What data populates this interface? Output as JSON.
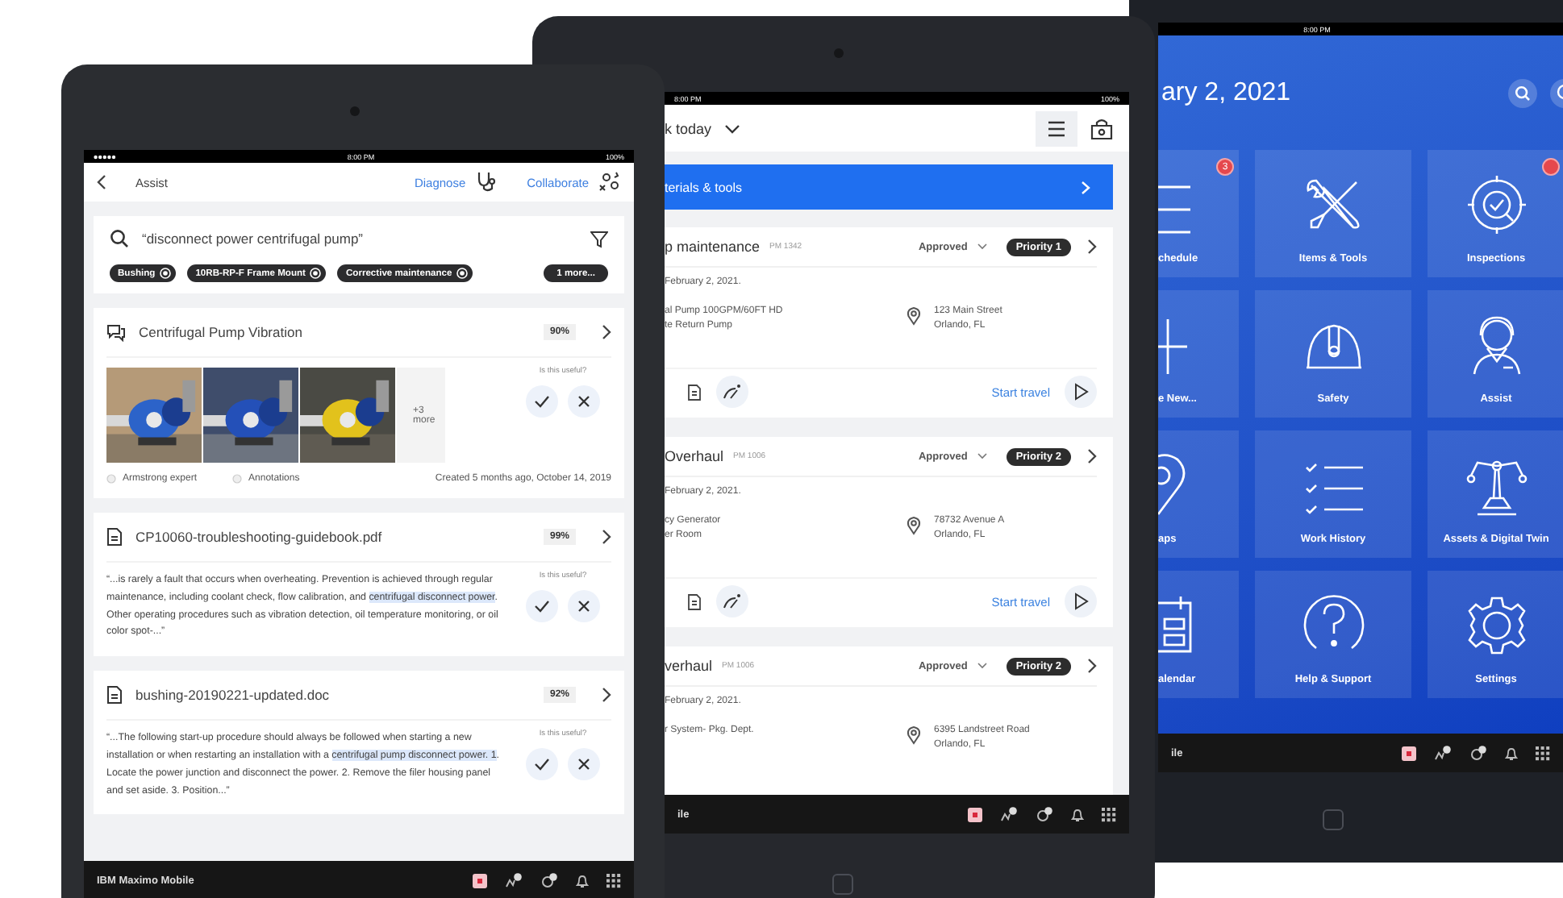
{
  "assist_tablet": {
    "status_bar": {
      "time": "8:00 PM",
      "battery": "100%"
    },
    "header": {
      "title": "Assist",
      "actions": [
        {
          "label": "Diagnose"
        },
        {
          "label": "Collaborate"
        }
      ]
    },
    "search": {
      "value": "“disconnect power centrifugal pump”",
      "chips": [
        {
          "label": "Bushing",
          "removable": true
        },
        {
          "label": "10RB-RP-F Frame Mount",
          "removable": true
        },
        {
          "label": "Corrective maintenance",
          "removable": true
        },
        {
          "label": "1 more...",
          "removable": false
        }
      ]
    },
    "results": [
      {
        "kind": "media",
        "title": "Centrifugal Pump Vibration",
        "score": "90%",
        "more_label": "+3 more",
        "feedback_prompt": "Is this useful?",
        "author": "Armstrong expert",
        "annotations": "Annotations",
        "created": "Created 5 months ago, October 14, 2019"
      },
      {
        "kind": "document",
        "title": "CP10060-troubleshooting-guidebook.pdf",
        "score": "99%",
        "feedback_prompt": "Is this useful?",
        "excerpt": [
          {
            "text": "“...is rarely a fault that occurs when overheating. Prevention is achieved through regular maintenance, including coolant check, flow calibration, and ",
            "highlighted": false
          },
          {
            "text": "centrifugal disconnect power",
            "highlighted": true
          },
          {
            "text": ". Other operating procedures such as vibration detection, oil temperature monitoring, or oil color spot-...”",
            "highlighted": false
          }
        ]
      },
      {
        "kind": "document",
        "title": "bushing-20190221-updated.doc",
        "score": "92%",
        "feedback_prompt": "Is this useful?",
        "excerpt": [
          {
            "text": "“...The following start-up procedure should always be followed when starting a new installation or when restarting an installation with a ",
            "highlighted": false
          },
          {
            "text": "centrifugal pump disconnect power. 1",
            "highlighted": true
          },
          {
            "text": ". Locate the power junction and disconnect the power. 2. Remove the filer housing panel and set aside. 3. Position...”",
            "highlighted": false
          }
        ]
      }
    ],
    "bottom_bar": {
      "brand": "IBM Maximo Mobile"
    }
  },
  "work_list_tablet": {
    "status_bar": {
      "time": "8:00 PM",
      "battery": "100%"
    },
    "header": {
      "title": "k today"
    },
    "banner": {
      "label": "terials & tools"
    },
    "work_orders": [
      {
        "title": "p maintenance",
        "number": "PM 1342",
        "status": "Approved",
        "priority": "Priority 1",
        "date": "February 2, 2021.",
        "asset_lines": [
          "al Pump 100GPM/60FT HD",
          "te Return Pump"
        ],
        "address_lines": [
          "123 Main Street",
          "Orlando, FL"
        ],
        "action": "Start travel"
      },
      {
        "title": "Overhaul",
        "number": "PM 1006",
        "status": "Approved",
        "priority": "Priority 2",
        "date": "February 2, 2021.",
        "asset_lines": [
          "cy Generator",
          "er Room"
        ],
        "address_lines": [
          "78732 Avenue A",
          "Orlando, FL"
        ],
        "action": "Start travel"
      },
      {
        "title": "verhaul",
        "number": "PM 1006",
        "status": "Approved",
        "priority": "Priority 2",
        "date": "February 2, 2021.",
        "asset_lines": [
          "r System- Pkg. Dept."
        ],
        "address_lines": [
          "6395 Landstreet Road",
          "Orlando, FL"
        ]
      }
    ],
    "bottom_bar": {
      "brand": "ile"
    }
  },
  "home_tablet": {
    "status_bar": {
      "time": "8:00 PM"
    },
    "title": "ary 2, 2021",
    "tiles": [
      {
        "label": "chedule",
        "alert": true,
        "badge_count": "3"
      },
      {
        "label": "Items & Tools",
        "alert": false
      },
      {
        "label": "Inspections",
        "alert": true
      },
      {
        "label": "e New...",
        "alert": false
      },
      {
        "label": "Safety",
        "alert": false
      },
      {
        "label": "Assist",
        "alert": false
      },
      {
        "label": "aps",
        "alert": false
      },
      {
        "label": "Work History",
        "alert": false
      },
      {
        "label": "Assets & Digital Twin",
        "alert": false
      },
      {
        "label": "alendar",
        "alert": false
      },
      {
        "label": "Help & Support",
        "alert": false
      },
      {
        "label": "Settings",
        "alert": false
      }
    ],
    "bottom_bar": {
      "brand": "ile"
    }
  }
}
